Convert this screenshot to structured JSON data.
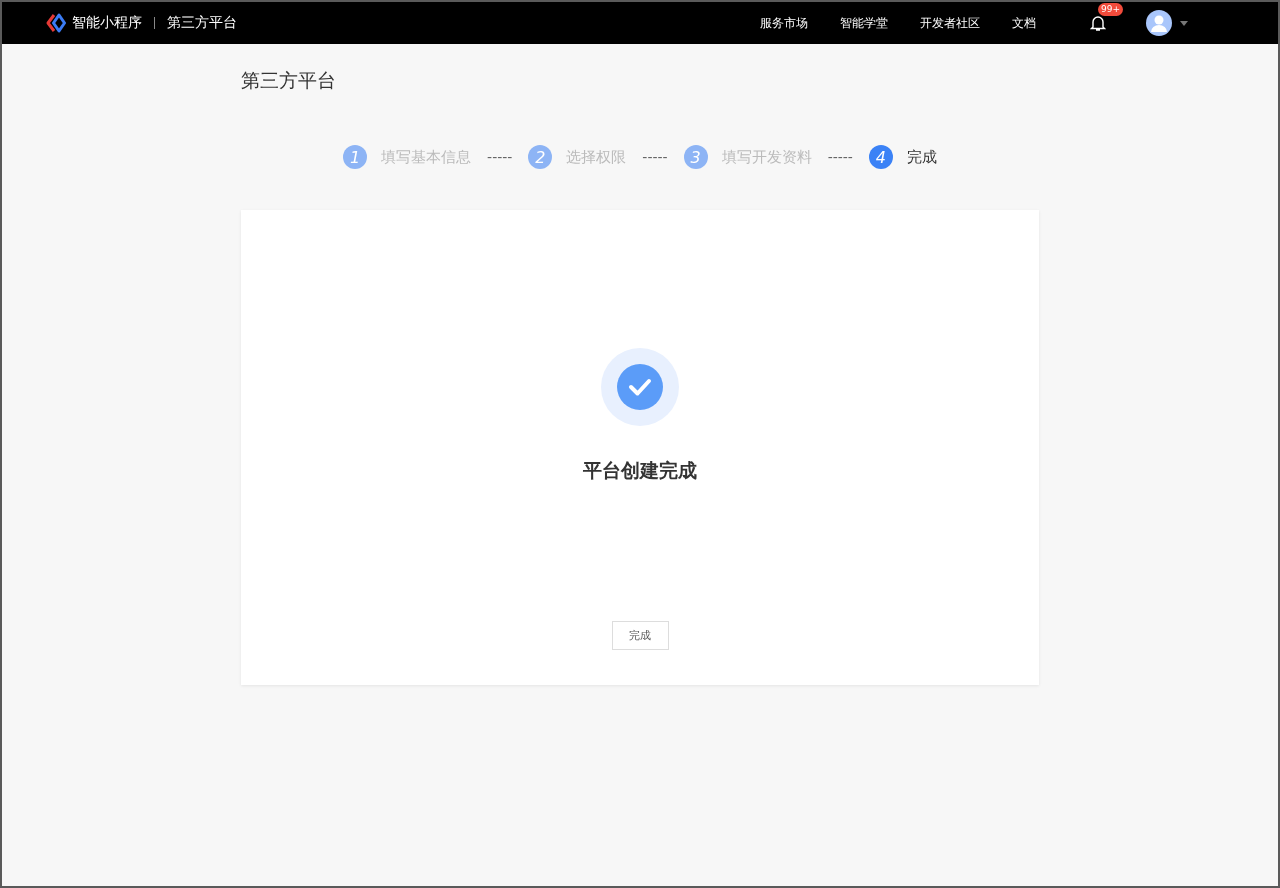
{
  "header": {
    "brand": "智能小程序",
    "section": "第三方平台",
    "nav": [
      "服务市场",
      "智能学堂",
      "开发者社区",
      "文档"
    ],
    "badge": "99+"
  },
  "page_title": "第三方平台",
  "steps": [
    {
      "number": "1",
      "label": "填写基本信息",
      "selected": false,
      "separator": "-----"
    },
    {
      "number": "2",
      "label": "选择权限",
      "selected": false,
      "separator": "-----"
    },
    {
      "number": "3",
      "label": "填写开发资料",
      "selected": false,
      "separator": "-----"
    },
    {
      "number": "4",
      "label": "完成",
      "selected": true
    }
  ],
  "result": {
    "message": "平台创建完成",
    "button": "完成"
  }
}
